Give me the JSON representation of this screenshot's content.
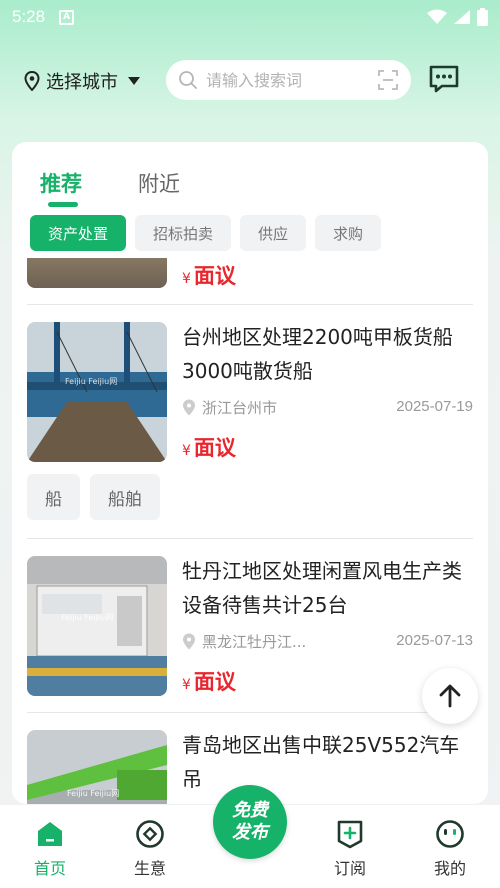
{
  "status_bar": {
    "time": "5:28",
    "notification_letter": "A"
  },
  "header": {
    "city_label": "选择城市",
    "search_placeholder": "请输入搜索词"
  },
  "tabs": [
    {
      "label": "推荐",
      "active": true
    },
    {
      "label": "附近",
      "active": false
    }
  ],
  "chips": [
    {
      "label": "资产处置",
      "active": true
    },
    {
      "label": "招标拍卖",
      "active": false
    },
    {
      "label": "供应",
      "active": false
    },
    {
      "label": "求购",
      "active": false
    }
  ],
  "listings": [
    {
      "price": "面议",
      "currency": "¥"
    },
    {
      "title": "台州地区处理2200吨甲板货船 3000吨散货船",
      "location": "浙江台州市",
      "date": "2025-07-19",
      "price": "面议",
      "currency": "¥",
      "tags": [
        "船",
        "船舶"
      ]
    },
    {
      "title": "牡丹江地区处理闲置风电生产类设备待售共计25台",
      "location": "黑龙江牡丹江...",
      "date": "2025-07-13",
      "price": "面议",
      "currency": "¥"
    },
    {
      "title": "青岛地区出售中联25V552汽车吊"
    }
  ],
  "bottom_nav": {
    "items": [
      {
        "label": "首页",
        "icon": "home-icon",
        "active": true
      },
      {
        "label": "生意",
        "icon": "business-icon",
        "active": false
      },
      {
        "label": "订阅",
        "icon": "subscribe-icon",
        "active": false
      },
      {
        "label": "我的",
        "icon": "profile-icon",
        "active": false
      }
    ],
    "publish_line1": "免费",
    "publish_line2": "发布"
  },
  "colors": {
    "accent": "#17b26a",
    "price": "#e8262d"
  }
}
